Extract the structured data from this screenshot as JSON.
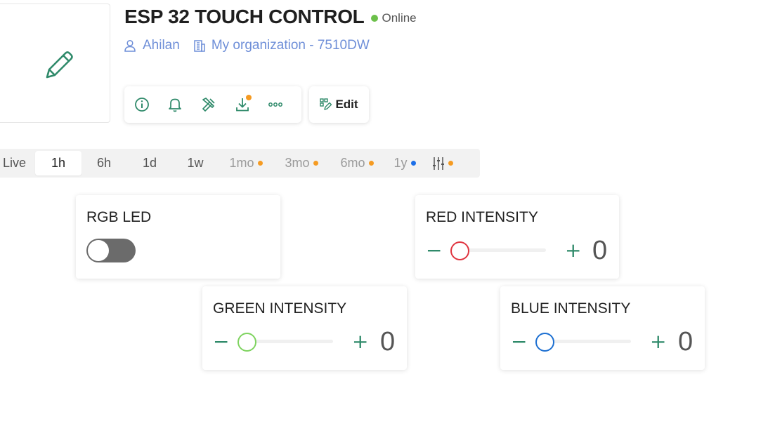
{
  "device": {
    "title": "ESP 32 TOUCH CONTROL",
    "status": "Online",
    "owner": "Ahilan",
    "organization": "My organization - 7510DW"
  },
  "toolbar": {
    "icons": [
      "info-icon",
      "bell-icon",
      "tools-icon",
      "download-icon",
      "more-icon"
    ],
    "edit_label": "Edit"
  },
  "time_ranges": [
    "Live",
    "1h",
    "6h",
    "1d",
    "1w",
    "1mo",
    "3mo",
    "6mo",
    "1y"
  ],
  "time_range_active": "1h",
  "widgets": {
    "rgb_led": {
      "title": "RGB LED",
      "on": false
    },
    "red": {
      "title": "RED INTENSITY",
      "value": "0",
      "color": "#e0343f"
    },
    "green": {
      "title": "GREEN INTENSITY",
      "value": "0",
      "color": "#7ed35f"
    },
    "blue": {
      "title": "BLUE INTENSITY",
      "value": "0",
      "color": "#1c6fd1"
    }
  },
  "colors": {
    "accent": "#2f8a6a",
    "link": "#6f8fd8",
    "online": "#6cc04a",
    "badge_orange": "#f59b22",
    "badge_blue": "#1c6fe8"
  }
}
